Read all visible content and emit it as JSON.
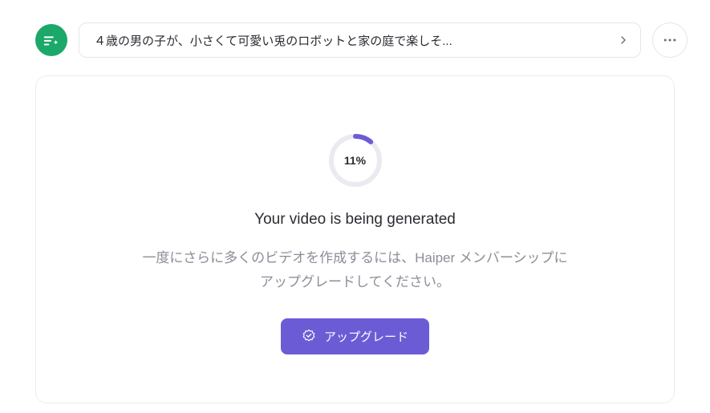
{
  "header": {
    "prompt_text": "４歳の男の子が、小さくて可愛い兎のロボットと家の庭で楽しそ...",
    "logo_bg": "#1ba868"
  },
  "progress": {
    "percent": 11,
    "percent_label": "11%"
  },
  "heading": "Your video is being generated",
  "subtext": "一度にさらに多くのビデオを作成するには、Haiper メンバーシップにアップグレードしてください。",
  "upgrade_label": "アップグレード",
  "colors": {
    "accent": "#6b5cd6",
    "ring_track": "#eceaf1",
    "ring_fill": "#6b5cd6"
  }
}
